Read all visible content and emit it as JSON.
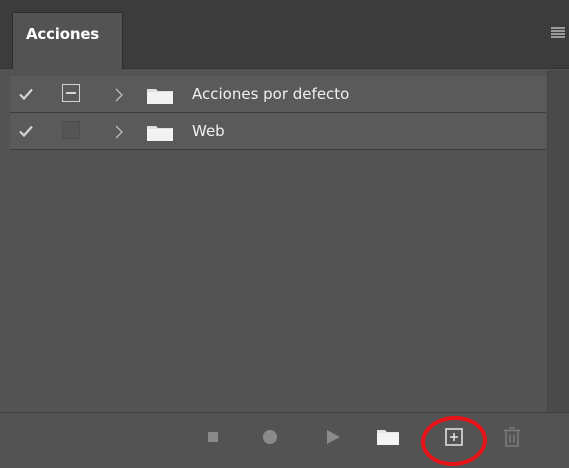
{
  "panel": {
    "tab_label": "Acciones",
    "menu_icon": "hamburger-menu-icon"
  },
  "actions": [
    {
      "label": "Acciones por defecto",
      "checked": true,
      "dialog_toggle": true,
      "icons": [
        "checkmark-icon",
        "dialog-toggle-icon",
        "chevron-right-icon",
        "folder-icon"
      ]
    },
    {
      "label": "Web",
      "checked": true,
      "dialog_toggle": false,
      "icons": [
        "checkmark-icon",
        "dialog-toggle-icon",
        "chevron-right-icon",
        "folder-icon"
      ]
    }
  ],
  "toolbar": {
    "icons": [
      "stop-icon",
      "record-icon",
      "play-icon",
      "new-set-folder-icon",
      "new-action-icon",
      "trash-icon"
    ]
  },
  "colors": {
    "panel_bg": "#535353",
    "tabbar_bg": "#3c3c3c",
    "row_bg": "#5a5a5a",
    "text": "#f0f0f0",
    "icon": "#d4d4d4",
    "highlight": "#e8141a"
  }
}
